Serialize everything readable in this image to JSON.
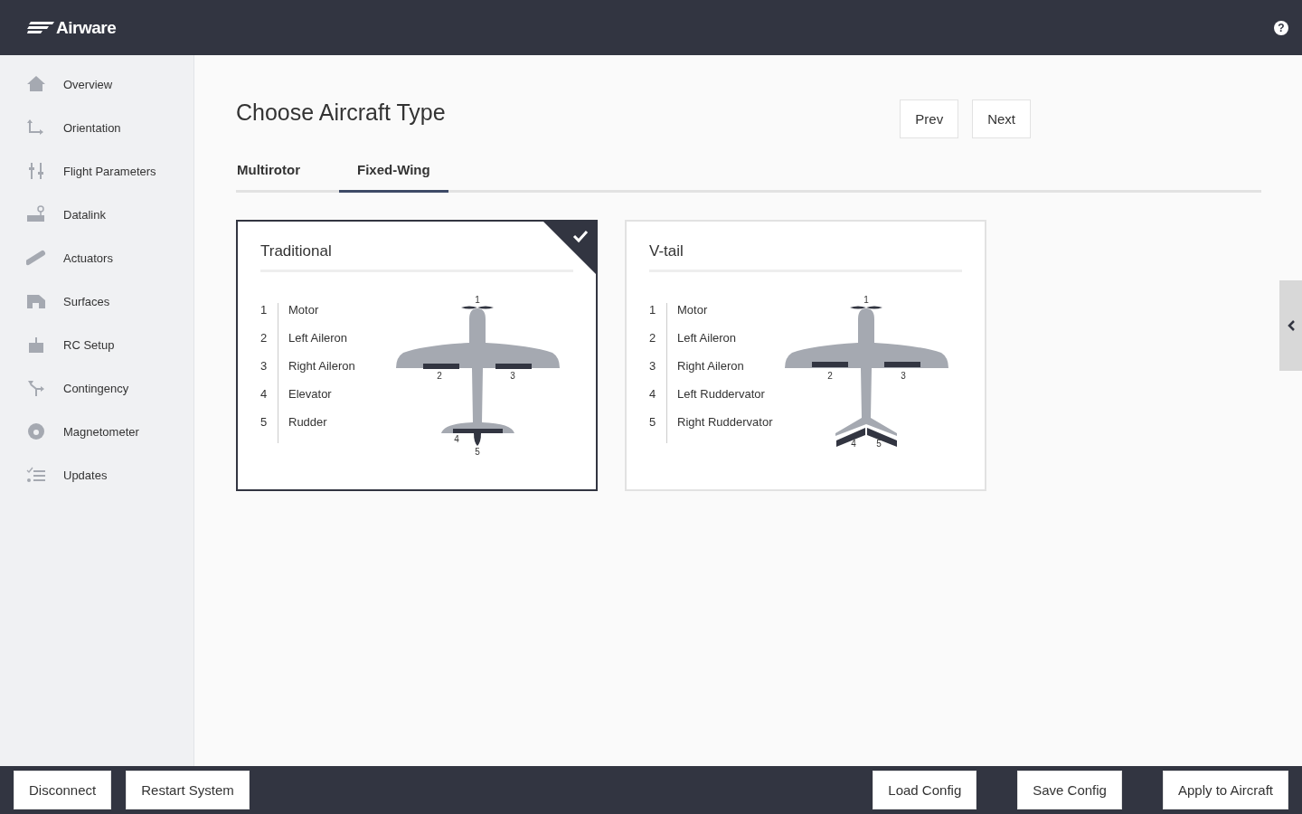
{
  "header": {
    "logo": "Airware",
    "help": "?"
  },
  "sidebar": {
    "items": [
      {
        "label": "Overview"
      },
      {
        "label": "Orientation"
      },
      {
        "label": "Flight Parameters"
      },
      {
        "label": "Datalink"
      },
      {
        "label": "Actuators"
      },
      {
        "label": "Surfaces"
      },
      {
        "label": "RC Setup"
      },
      {
        "label": "Contingency"
      },
      {
        "label": "Magnetometer"
      },
      {
        "label": "Updates"
      }
    ]
  },
  "page": {
    "title": "Choose Aircraft Type",
    "buttons": [
      "Prev",
      "Next"
    ]
  },
  "tabs": [
    {
      "label": "Multirotor",
      "selected": false
    },
    {
      "label": "Fixed-Wing",
      "selected": true
    }
  ],
  "cards": [
    {
      "title": "Traditional",
      "kind": "conventional",
      "selected": true,
      "parts": [
        {
          "number": "1",
          "name": "Motor"
        },
        {
          "number": "2",
          "name": "Left Aileron"
        },
        {
          "number": "3",
          "name": "Right Aileron"
        },
        {
          "number": "4",
          "name": "Elevator"
        },
        {
          "number": "5",
          "name": "Rudder"
        }
      ],
      "diagram_labels": [
        "1",
        "2",
        "3",
        "4",
        "5"
      ]
    },
    {
      "title": "V-tail",
      "kind": "v-tail",
      "selected": false,
      "parts": [
        {
          "number": "1",
          "name": "Motor"
        },
        {
          "number": "2",
          "name": "Left Aileron"
        },
        {
          "number": "3",
          "name": "Right Aileron"
        },
        {
          "number": "4",
          "name": "Left Ruddervator"
        },
        {
          "number": "5",
          "name": "Right Ruddervator"
        }
      ],
      "diagram_labels": [
        "1",
        "2",
        "3",
        "4",
        "5"
      ]
    }
  ],
  "footer": {
    "left_buttons": [
      "Disconnect",
      "Restart System"
    ],
    "right_buttons": [
      "Load Config",
      "Save Config",
      "Apply to Aircraft"
    ]
  }
}
